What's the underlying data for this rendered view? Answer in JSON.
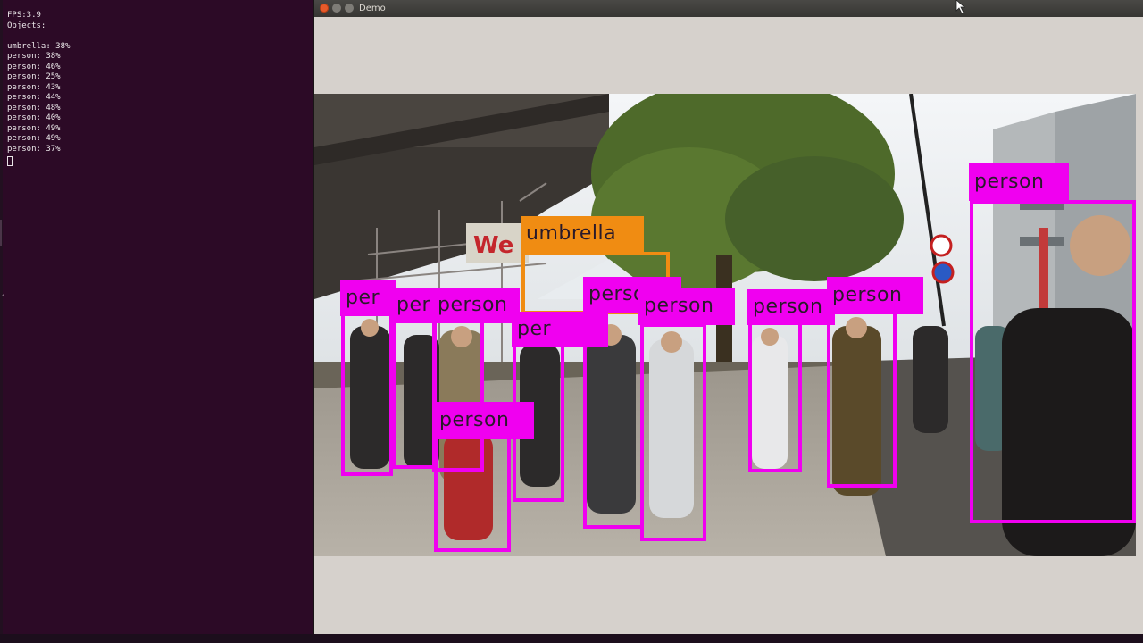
{
  "terminal": {
    "lines": [
      "FPS:3.9",
      "Objects:",
      "",
      "umbrella: 38%",
      "person: 38%",
      "person: 46%",
      "person: 25%",
      "person: 43%",
      "person: 44%",
      "person: 48%",
      "person: 40%",
      "person: 49%",
      "person: 49%",
      "person: 37%"
    ]
  },
  "window": {
    "title": "Demo"
  },
  "detections": {
    "umbrella_label": "umbrella",
    "labels": {
      "p1": "per",
      "p2": "per",
      "p3": "person",
      "p4": "person",
      "p5": "per",
      "p6": "person",
      "p7": "person",
      "p8": "person",
      "p9": "person",
      "p10": "person"
    }
  },
  "sign_text": "We",
  "colors": {
    "person_box": "#f000f0",
    "umbrella_box": "#f08c12",
    "terminal_bg": "#2c0a26",
    "window_bg": "#d6d1cc"
  }
}
